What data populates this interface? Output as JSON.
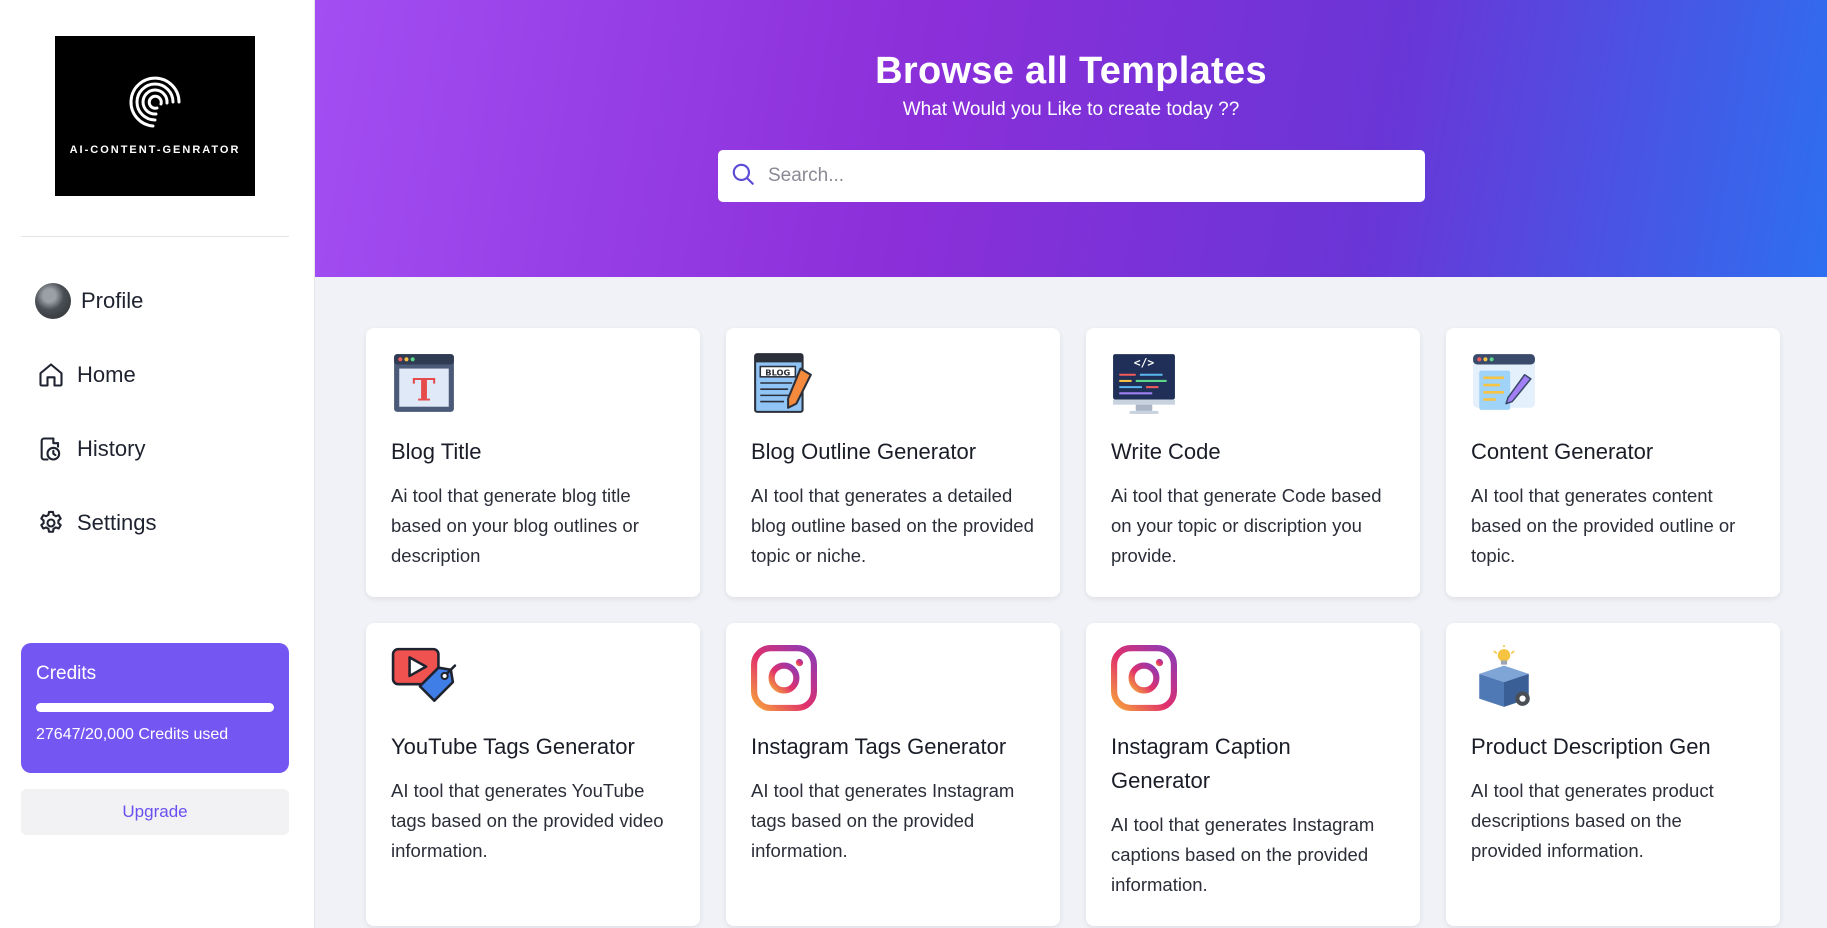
{
  "sidebar": {
    "logo_text": "AI-CONTENT-GENRATOR",
    "nav": [
      {
        "label": "Profile",
        "icon": "avatar"
      },
      {
        "label": "Home",
        "icon": "home-icon"
      },
      {
        "label": "History",
        "icon": "history-icon"
      },
      {
        "label": "Settings",
        "icon": "gear-icon"
      }
    ],
    "credits": {
      "title": "Credits",
      "used_text": "27647/20,000 Credits used",
      "progress_fraction": 1.0
    },
    "upgrade_label": "Upgrade"
  },
  "header": {
    "title": "Browse all Templates",
    "subtitle": "What Would you Like to create today ??",
    "search_placeholder": "Search..."
  },
  "templates": [
    {
      "title": "Blog Title",
      "desc": "Ai tool that generate blog title based on your blog outlines or description",
      "icon": "blog-title-icon"
    },
    {
      "title": "Blog Outline Generator",
      "desc": "AI tool that generates a detailed blog outline based on the provided topic or niche.",
      "icon": "blog-outline-icon"
    },
    {
      "title": "Write Code",
      "desc": "Ai tool that generate Code based on your topic or discription you provide.",
      "icon": "code-icon"
    },
    {
      "title": "Content Generator",
      "desc": "AI tool that generates content based on the provided outline or topic.",
      "icon": "content-icon"
    },
    {
      "title": "YouTube Tags Generator",
      "desc": "AI tool that generates YouTube tags based on the provided video information.",
      "icon": "youtube-tag-icon"
    },
    {
      "title": "Instagram Tags Generator",
      "desc": "AI tool that generates Instagram tags based on the provided information.",
      "icon": "instagram-icon"
    },
    {
      "title": "Instagram Caption Generator",
      "desc": "AI tool that generates Instagram captions based on the provided information.",
      "icon": "instagram-icon"
    },
    {
      "title": "Product Description Gen",
      "desc": "AI tool that generates product descriptions based on the provided information.",
      "icon": "product-box-icon"
    }
  ],
  "colors": {
    "accent": "#7457f3",
    "header_gradient_start": "#a24ef3",
    "header_gradient_end": "#2d6ff0"
  }
}
